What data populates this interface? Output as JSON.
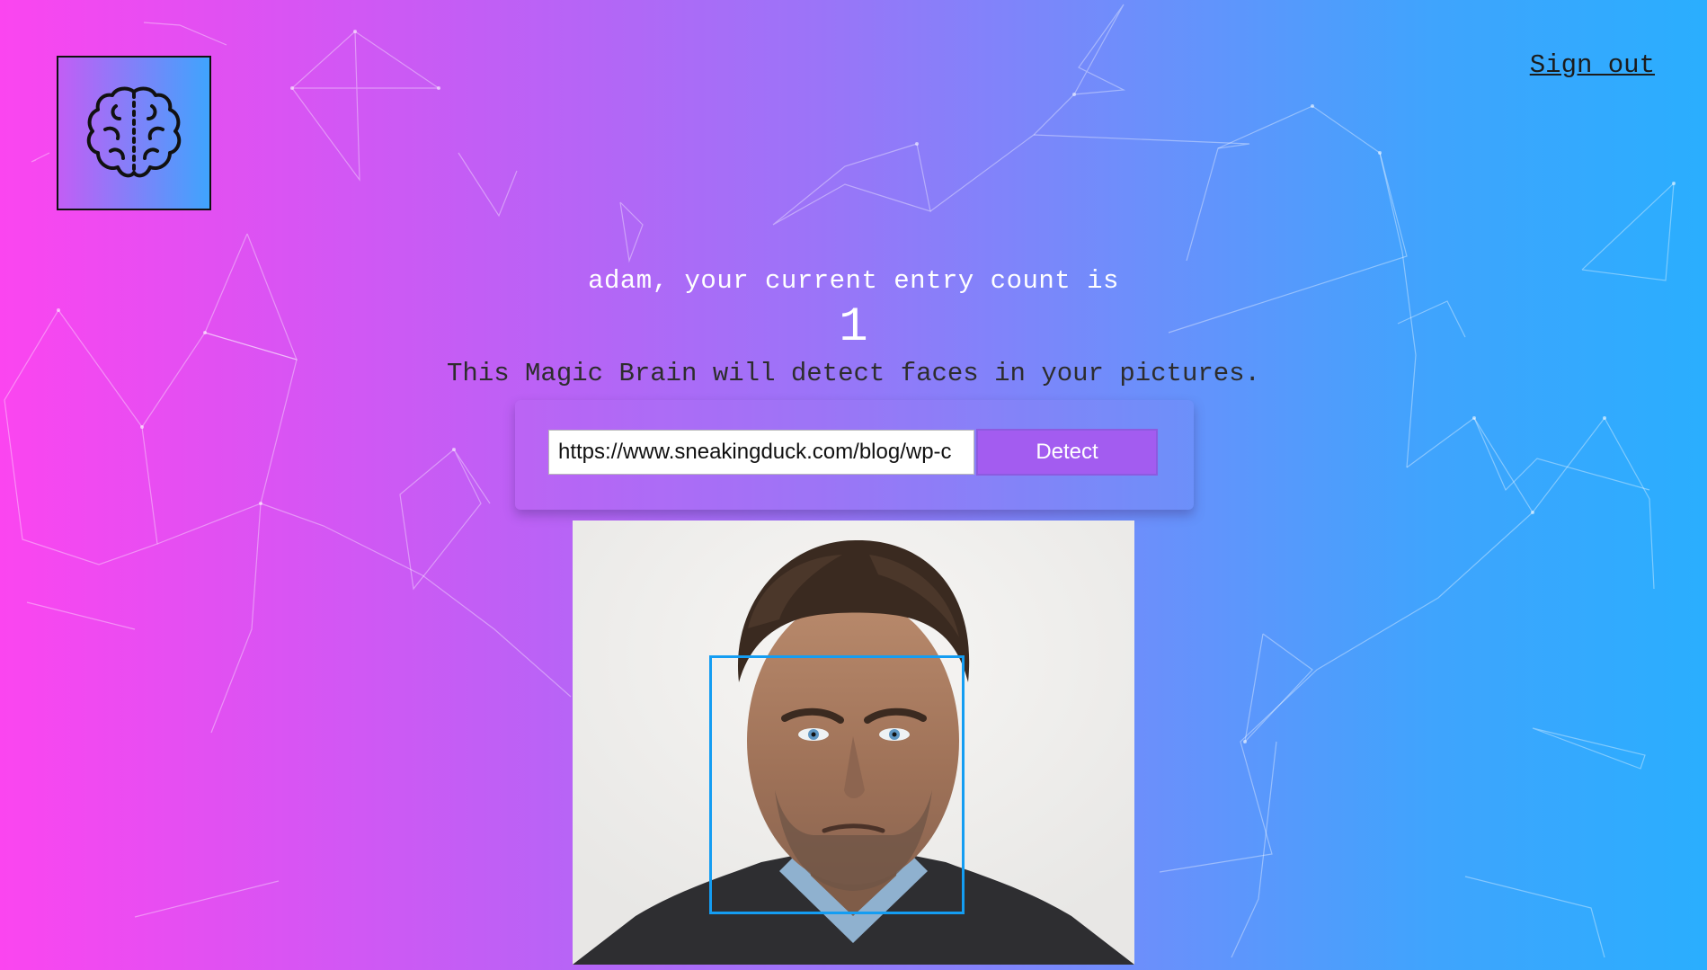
{
  "header": {
    "logo_icon": "brain-icon",
    "signout_label": "Sign out"
  },
  "rank": {
    "greeting": "adam, your current entry count is",
    "count": "1"
  },
  "tagline": "This Magic Brain will detect faces in your pictures.",
  "form": {
    "url_value": "https://www.sneakingduck.com/blog/wp-c",
    "detect_label": "Detect"
  },
  "result": {
    "image_icon": "face-photo",
    "box_color": "#149df2"
  },
  "colors": {
    "gradient_start": "#fb45f0",
    "gradient_end": "#2aaefe",
    "button": "#a35cf0"
  }
}
